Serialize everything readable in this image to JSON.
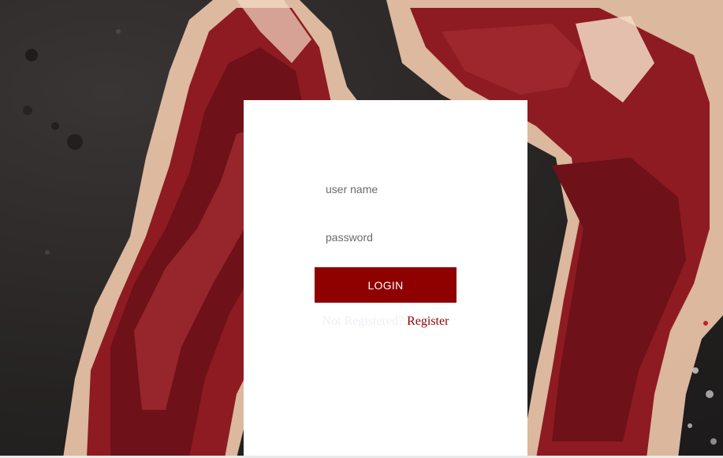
{
  "login_form": {
    "username_placeholder": "user name",
    "password_placeholder": "password",
    "login_label": "LOGIN",
    "register_hint": "Not Registered?",
    "register_link": "Register"
  },
  "colors": {
    "accent": "#8f0000",
    "card_background": "#ffffff"
  },
  "background": {
    "image": "raw-t-bone-steaks-on-dark-slate"
  }
}
